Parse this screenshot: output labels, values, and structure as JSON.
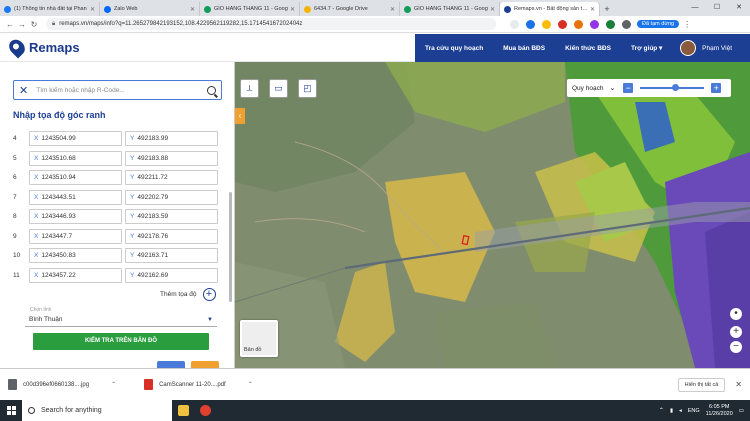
{
  "browser": {
    "tabs": [
      {
        "title": "(1) Thông tin nhà đất tại Phan",
        "color": "#1877f2"
      },
      {
        "title": "Zalo Web",
        "color": "#0068ff"
      },
      {
        "title": "GIỎ HÀNG THÁNG 11 - Goog",
        "color": "#0f9d58"
      },
      {
        "title": "6434.7 - Google Drive",
        "color": "#f4b400"
      },
      {
        "title": "GIỎ HÀNG THÁNG 11 - Goog",
        "color": "#0f9d58"
      },
      {
        "title": "Remaps.vn - Bất động sản thật",
        "color": "#1c3f94"
      }
    ],
    "url": "remaps.vn/maps/info?q=11.265279842193152,108.4229562119282,15.171454167202404z",
    "paused_label": "Đã tạm dừng"
  },
  "header": {
    "logo_text": "Remaps",
    "menu": [
      "Tra cứu quy hoạch",
      "Mua bán BĐS",
      "Kiến thức BĐS",
      "Trợ giúp ▾"
    ],
    "user_name": "Phạm Việt"
  },
  "panel": {
    "search_placeholder": "Tìm kiếm hoặc nhập R-Code...",
    "title": "Nhập tọa độ góc ranh",
    "coord_rows": [
      {
        "n": "4",
        "x": "1243504.99",
        "y": "492183.99"
      },
      {
        "n": "5",
        "x": "1243510.68",
        "y": "492183.88"
      },
      {
        "n": "6",
        "x": "1243510.94",
        "y": "492211.72"
      },
      {
        "n": "7",
        "x": "1243443.51",
        "y": "492202.79"
      },
      {
        "n": "8",
        "x": "1243446.93",
        "y": "492183.59"
      },
      {
        "n": "9",
        "x": "1243447.7",
        "y": "492178.76"
      },
      {
        "n": "10",
        "x": "1243450.83",
        "y": "492163.71"
      },
      {
        "n": "11",
        "x": "1243457.22",
        "y": "492162.69"
      }
    ],
    "x_prefix": "X",
    "y_prefix": "Y",
    "add_coord_label": "Thêm tọa độ",
    "province_label": "Chọn tỉnh",
    "province_value": "Bình Thuận",
    "check_button": "KIỂM TRA TRÊN BẢN ĐỒ"
  },
  "map": {
    "layer_label": "Quy hoạch",
    "basemap_label": "Bản đồ",
    "zoom_in": "+",
    "zoom_out": "−",
    "opacity_minus": "−",
    "opacity_plus": "+",
    "colors": {
      "yellow": "#d7b94a",
      "green": "#7fbf3a",
      "purple": "#6a49b8",
      "blue": "#3a6fb5",
      "parcel": "#e02020"
    }
  },
  "downloads": {
    "items": [
      "c00d396ef0660138....jpg",
      "CamScanner 11-20....pdf"
    ],
    "show_all": "Hiển thị tất cả"
  },
  "taskbar": {
    "search_placeholder": "Search for anything",
    "lang": "ENG",
    "time": "6:05 PM",
    "date": "11/26/2020"
  }
}
